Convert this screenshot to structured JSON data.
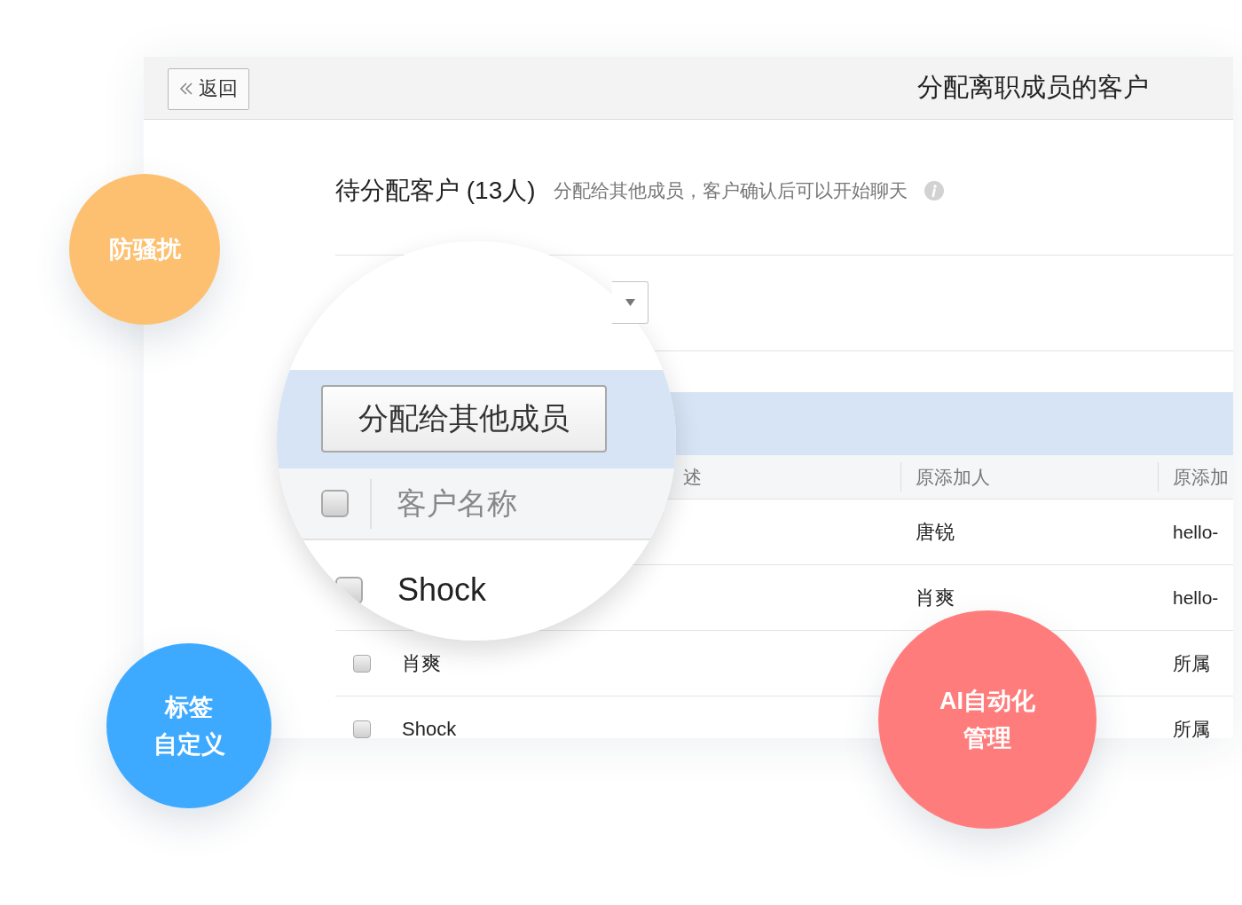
{
  "header": {
    "back_button": "返回",
    "title": "分配离职成员的客户"
  },
  "section": {
    "title": "待分配客户 (13人)",
    "hint": "分配给其他成员，客户确认后可以开始聊天"
  },
  "table": {
    "columns": [
      {
        "label": "述"
      },
      {
        "label": "原添加人"
      },
      {
        "label": "原添加"
      }
    ],
    "rows": [
      {
        "added_by": "唐锐",
        "column_5": "hello-"
      },
      {
        "added_by": "肖爽",
        "column_5": "hello-"
      },
      {
        "checked": false,
        "name": "肖爽",
        "column_5": "所属"
      },
      {
        "checked": false,
        "name": "Shock",
        "column_5": "所属"
      }
    ]
  },
  "magnifier": {
    "button": "分配给其他成员",
    "header_checked": false,
    "column": "客户名称",
    "row": {
      "checked": false,
      "name": "Shock"
    }
  },
  "badges": [
    {
      "lines": [
        "防骚扰"
      ],
      "color": "#fdc070"
    },
    {
      "lines": [
        "标签",
        "自定义"
      ],
      "color": "#3eaaff"
    },
    {
      "lines": [
        "AI自动化",
        "管理"
      ],
      "color": "#ff7c7c"
    }
  ]
}
